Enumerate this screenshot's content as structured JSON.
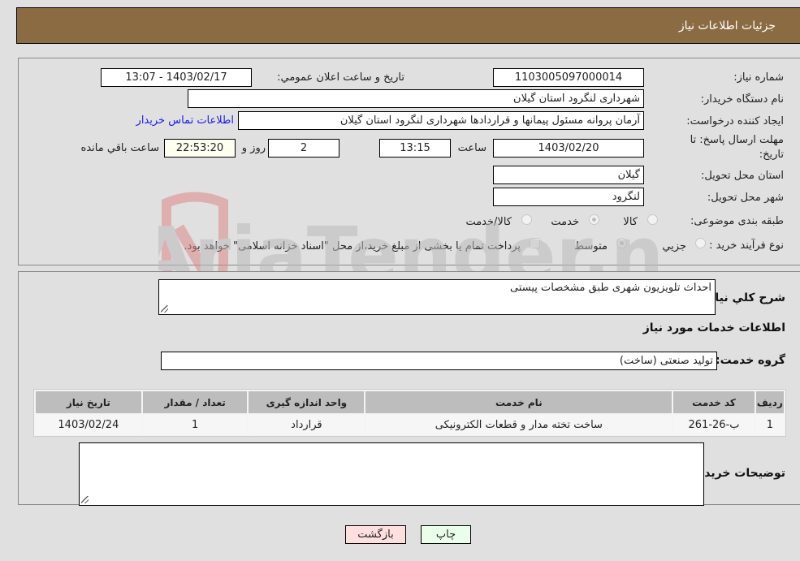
{
  "header": {
    "title": "جزئیات اطلاعات نیاز"
  },
  "form": {
    "need_number": {
      "label": "شماره نیاز:",
      "value": "1103005097000014"
    },
    "announce": {
      "label": "تاریخ و ساعت اعلان عمومي:",
      "value": "1403/02/17 - 13:07"
    },
    "buyer_org": {
      "label": "نام دستگاه خریدار:",
      "value": "شهرداری لنگرود استان گیلان"
    },
    "requester": {
      "label": "ایجاد کننده درخواست:",
      "value": "آرمان پروانه مسئول پیمانها و قراردادها شهرداری لنگرود استان گیلان"
    },
    "buyer_contact_link": "اطلاعات تماس خریدار",
    "deadline": {
      "label_line1": "مهلت ارسال پاسخ: تا",
      "label_line2": "تاریخ:",
      "date": "1403/02/20",
      "time_label": "ساعت",
      "time": "13:15",
      "days": "2",
      "days_label": "روز و",
      "remaining": "22:53:20",
      "remaining_label": "ساعت باقي مانده"
    },
    "province": {
      "label": "استان محل تحویل:",
      "value": "گیلان"
    },
    "city": {
      "label": "شهر محل تحویل:",
      "value": "لنگرود"
    },
    "category": {
      "label": "طبقه بندی موضوعی:",
      "options": [
        "کالا",
        "خدمت",
        "کالا/خدمت"
      ],
      "selected": "خدمت"
    },
    "process": {
      "label": "نوع فرآیند خرید :",
      "options": [
        "جزيي",
        "متوسط"
      ],
      "selected": "متوسط",
      "checkbox_text": "پرداخت تمام یا بخشی از مبلغ خرید،از محل \"اسناد خزانه اسلامی\" خواهد بود."
    }
  },
  "details": {
    "description_label": "شرح کلي نياز:",
    "description": "احداث تلویزیون شهری طبق مشخصات پیستی",
    "services_heading": "اطلاعات خدمات مورد نیاز",
    "service_group_label": "گروه خدمت:",
    "service_group": "تولید صنعتی (ساخت)",
    "table": {
      "headers": [
        "ردیف",
        "کد خدمت",
        "نام خدمت",
        "واحد اندازه گیری",
        "تعداد / مقدار",
        "تاریخ نیاز"
      ],
      "rows": [
        [
          "1",
          "ب-26-261",
          "ساخت تخته مدار و قطعات الکترونیکی",
          "قرارداد",
          "1",
          "1403/02/24"
        ]
      ]
    },
    "buyer_notes_label": "توضیحات خریدار:",
    "buyer_notes": ""
  },
  "buttons": {
    "print": "چاپ",
    "back": "بازگشت"
  },
  "watermark": {
    "text": "AriaTender.neT"
  },
  "colors": {
    "header_bg": "#8b6c42",
    "print_bg": "#eaffea",
    "back_bg": "#ffdede",
    "link": "#1a1aee"
  }
}
